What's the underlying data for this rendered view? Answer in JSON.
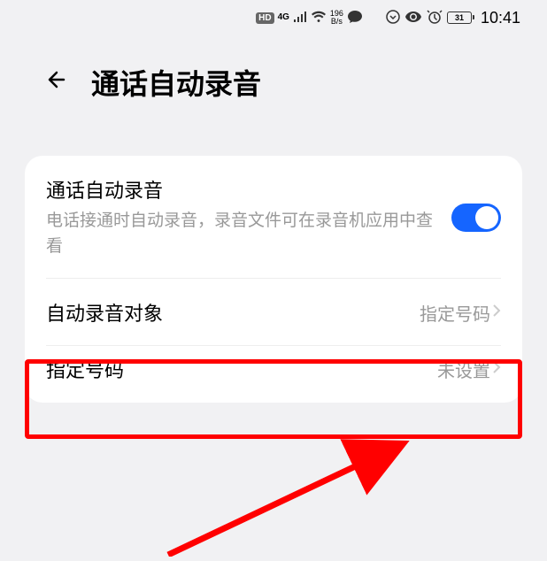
{
  "status_bar": {
    "hd": "HD",
    "signal_gen": "4G",
    "net_speed_num": "196",
    "net_speed_unit": "B/s",
    "battery": "31",
    "time": "10:41"
  },
  "header": {
    "title": "通话自动录音"
  },
  "settings": {
    "auto_record": {
      "title": "通话自动录音",
      "desc": "电话接通时自动录音，录音文件可在录音机应用中查看"
    },
    "record_target": {
      "title": "自动录音对象",
      "value": "指定号码"
    },
    "specify_number": {
      "title": "指定号码",
      "value": "未设置"
    }
  }
}
